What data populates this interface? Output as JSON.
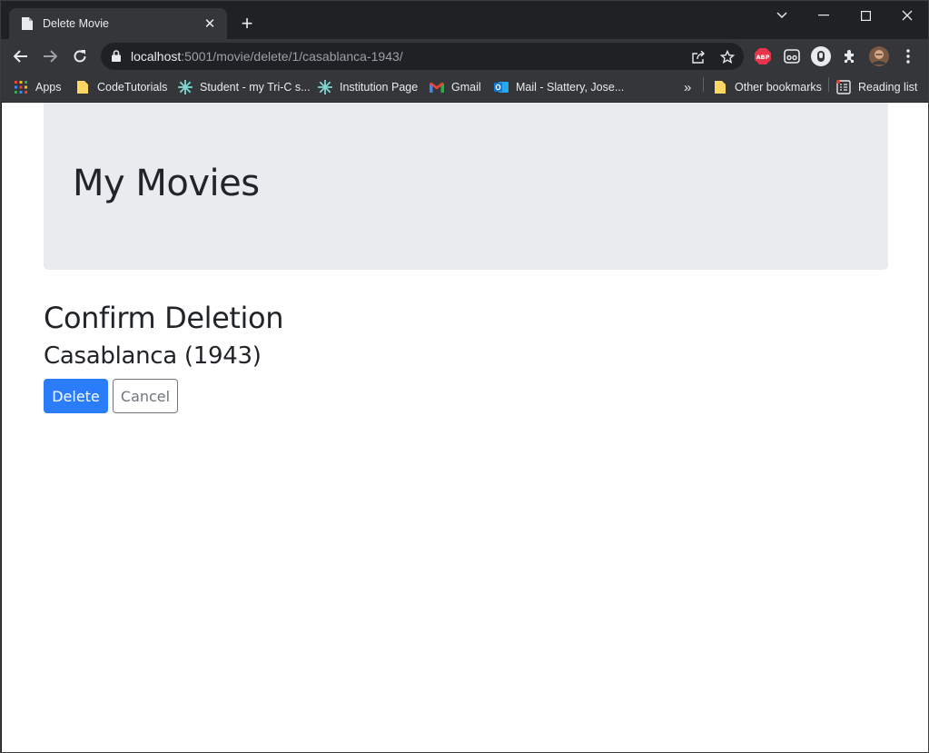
{
  "tab": {
    "title": "Delete Movie",
    "close_glyph": "✕"
  },
  "new_tab_glyph": "+",
  "address": {
    "host": "localhost",
    "path": ":5001/movie/delete/1/casablanca-1943/"
  },
  "bookmarks": [
    {
      "label": "Apps",
      "icon": "apps-grid-icon"
    },
    {
      "label": "CodeTutorials",
      "icon": "folder-icon"
    },
    {
      "label": "Student - my Tri-C s...",
      "icon": "snowflake-icon"
    },
    {
      "label": "Institution Page",
      "icon": "snowflake-icon"
    },
    {
      "label": "Gmail",
      "icon": "gmail-icon"
    },
    {
      "label": "Mail - Slattery, Jose...",
      "icon": "outlook-icon"
    }
  ],
  "bookmarks_overflow": "»",
  "other_bookmarks": "Other bookmarks",
  "reading_list": "Reading list",
  "page": {
    "site_title": "My Movies",
    "heading": "Confirm Deletion",
    "movie": "Casablanca (1943)",
    "delete_label": "Delete",
    "cancel_label": "Cancel"
  },
  "colors": {
    "primary": "#2b7cf8",
    "secondary": "#6c757d",
    "jumbotron": "#e9ecef"
  }
}
